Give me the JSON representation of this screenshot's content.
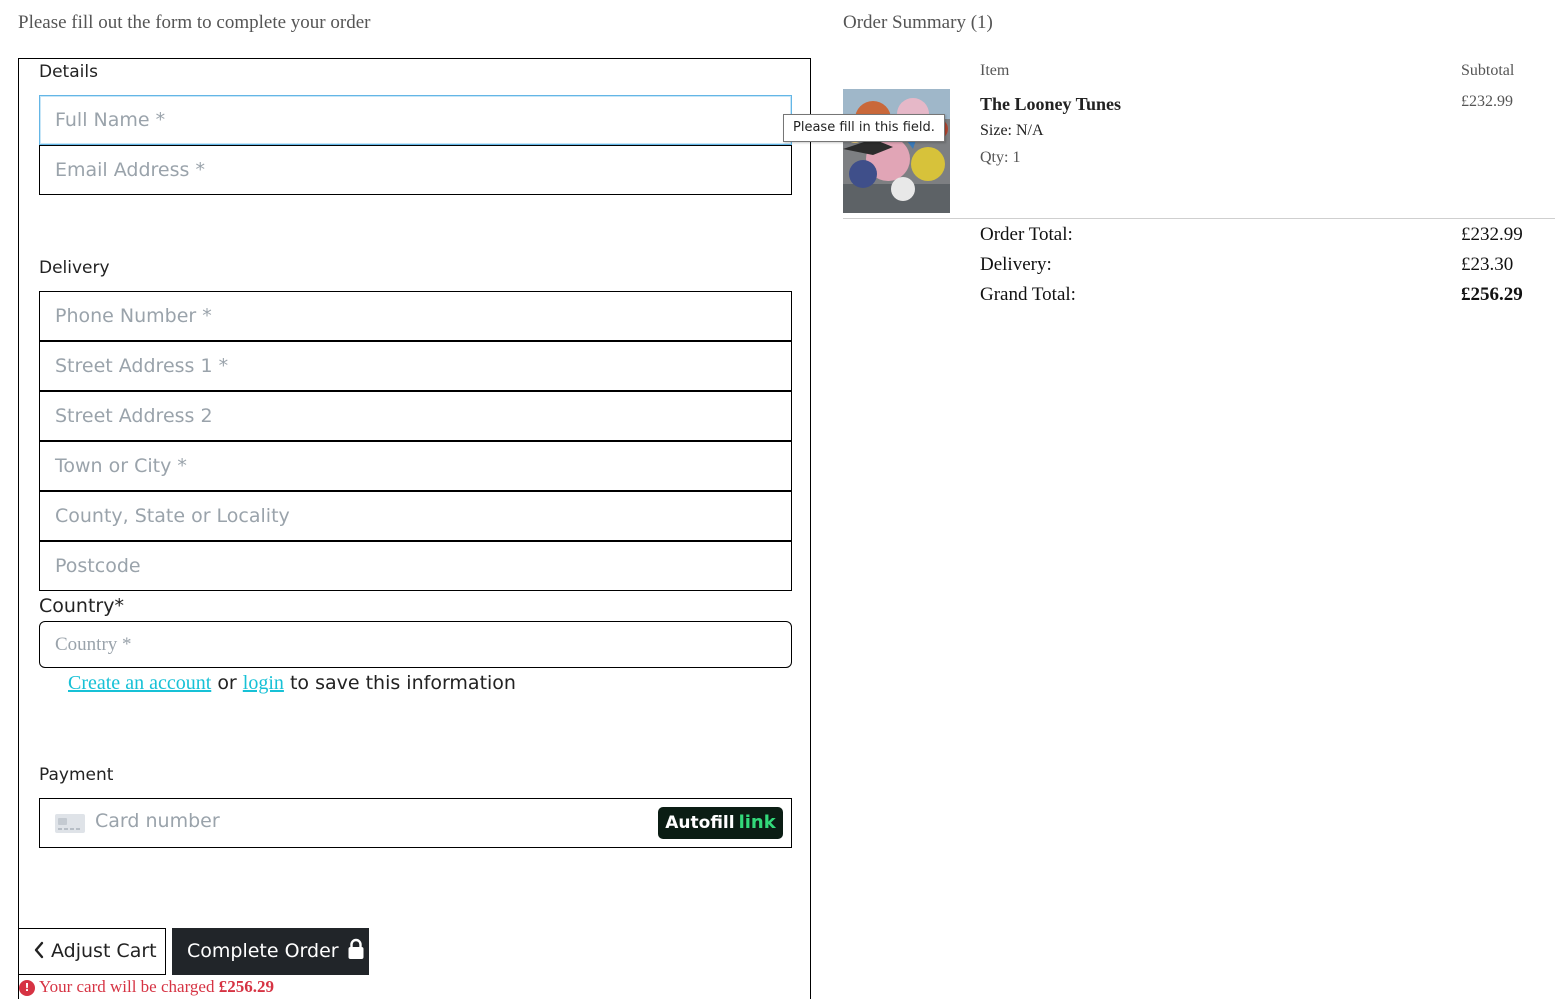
{
  "form": {
    "intro": "Please fill out the form to complete your order",
    "details_legend": "Details",
    "delivery_legend": "Delivery",
    "payment_legend": "Payment",
    "fields": {
      "full_name": "Full Name *",
      "email": "Email Address *",
      "phone": "Phone Number *",
      "street1": "Street Address 1 *",
      "street2": "Street Address 2",
      "town": "Town or City *",
      "county": "County, State or Locality",
      "postcode": "Postcode"
    },
    "country_label": "Country*",
    "country_placeholder": "Country *",
    "save_info": {
      "create_account": "Create an account",
      "or": "or",
      "login": "login",
      "suffix": "to save this information"
    },
    "card_placeholder": "Card number",
    "autofill": {
      "label": "Autofill",
      "brand": "link"
    },
    "tooltip": "Please fill in this field.",
    "buttons": {
      "adjust_cart": "Adjust Cart",
      "complete_order": "Complete Order"
    },
    "charge_warning": {
      "prefix": "Your card will be charged",
      "amount": "£256.29"
    }
  },
  "summary": {
    "heading": "Order Summary (1)",
    "col_item": "Item",
    "col_subtotal": "Subtotal",
    "product": {
      "name": "The Looney Tunes",
      "size": "Size: N/A",
      "qty": "Qty: 1",
      "subtotal": "£232.99"
    },
    "totals": {
      "order_total_label": "Order Total:",
      "order_total_value": "£232.99",
      "delivery_label": "Delivery:",
      "delivery_value": "£23.30",
      "grand_total_label": "Grand Total:",
      "grand_total_value": "£256.29"
    }
  },
  "colors": {
    "link": "#17c1d6",
    "focus_border": "#64b6e6",
    "error": "#d63343",
    "dark_button": "#212529",
    "autofill_bg": "#0b1d14",
    "autofill_brand": "#33d97a"
  },
  "icons": {
    "back": "chevron-left-icon",
    "lock": "lock-icon",
    "card": "credit-card-icon",
    "error": "exclamation-circle-icon"
  }
}
